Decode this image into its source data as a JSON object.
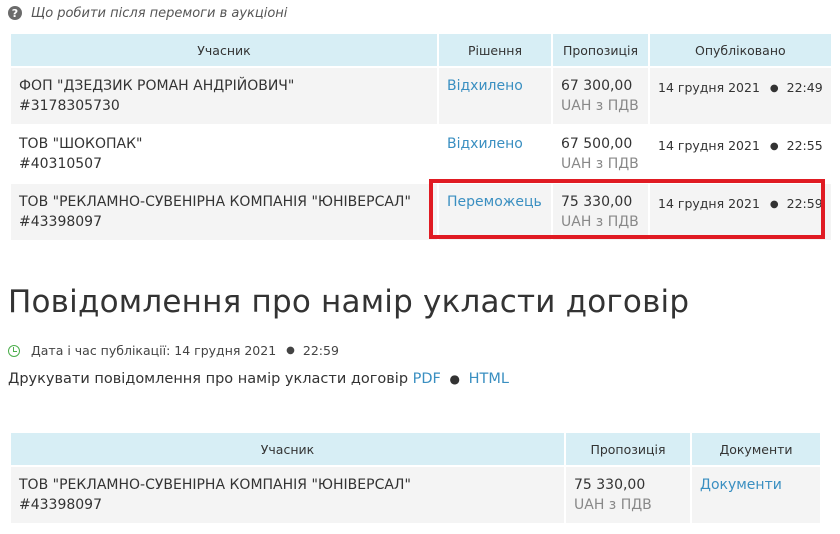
{
  "help": {
    "text": "Що робити після перемоги в аукціоні",
    "icon": "question-circle-icon"
  },
  "bids": {
    "headers": [
      "Учасник",
      "Рішення",
      "Пропозиція",
      "Опубліковано"
    ],
    "rows": [
      {
        "name": "ФОП \"ДЗЕДЗИК РОМАН АНДРІЙОВИЧ\"",
        "code": "#3178305730",
        "decision": "Відхилено",
        "amount": "67 300,00",
        "currency": "UAH з ПДВ",
        "date": "14 грудня 2021",
        "time": "22:49"
      },
      {
        "name": "ТОВ \"ШОКОПАК\"",
        "code": "#40310507",
        "decision": "Відхилено",
        "amount": "67 500,00",
        "currency": "UAH з ПДВ",
        "date": "14 грудня 2021",
        "time": "22:55"
      },
      {
        "name": "ТОВ \"РЕКЛАМНО-СУВЕНІРНА КОМПАНІЯ \"ЮНІВЕРСАЛ\"",
        "code": "#43398097",
        "decision": "Переможець",
        "amount": "75 330,00",
        "currency": "UAH з ПДВ",
        "date": "14 грудня 2021",
        "time": "22:59"
      }
    ]
  },
  "notice": {
    "title": "Повідомлення про намір укласти договір",
    "pub_label": "Дата і час публікації: 14 грудня 2021",
    "pub_time": "22:59",
    "print_text": "Друкувати повідомлення про намір укласти договір",
    "pdf": "PDF",
    "sep": "●",
    "html": "HTML"
  },
  "contract": {
    "headers": [
      "Учасник",
      "Пропозиція",
      "Документи"
    ],
    "row": {
      "name": "ТОВ \"РЕКЛАМНО-СУВЕНІРНА КОМПАНІЯ \"ЮНІВЕРСАЛ\"",
      "code": "#43398097",
      "amount": "75 330,00",
      "currency": "UAH з ПДВ",
      "docs": "Документи"
    }
  },
  "colors": {
    "header_bg": "#d7eef5",
    "link": "#3a8fc1",
    "highlight": "#e01b23",
    "clock": "#4cae4c"
  }
}
